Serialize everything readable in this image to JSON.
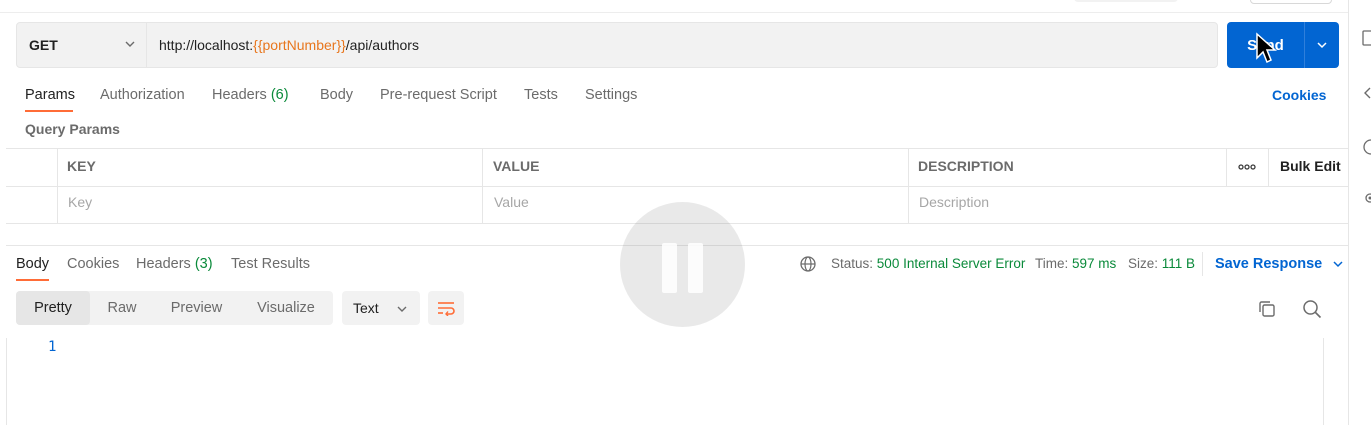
{
  "request": {
    "method": "GET",
    "url_prefix": "http://localhost:",
    "url_variable": "{{portNumber}}",
    "url_suffix": "/api/authors",
    "send_label": "Send"
  },
  "request_tabs": {
    "params": "Params",
    "authorization": "Authorization",
    "headers": "Headers",
    "headers_count": "(6)",
    "body": "Body",
    "pre_request": "Pre-request Script",
    "tests": "Tests",
    "settings": "Settings",
    "cookies": "Cookies"
  },
  "query_params": {
    "title": "Query Params",
    "columns": [
      "KEY",
      "VALUE",
      "DESCRIPTION"
    ],
    "bulk_edit": "Bulk Edit",
    "placeholders": {
      "key": "Key",
      "value": "Value",
      "description": "Description"
    }
  },
  "response_tabs": {
    "body": "Body",
    "cookies": "Cookies",
    "headers": "Headers",
    "headers_count": "(3)",
    "test_results": "Test Results"
  },
  "response_status": {
    "status_label": "Status:",
    "status_code": "500",
    "status_text": "Internal Server Error",
    "time_label": "Time:",
    "time_value": "597 ms",
    "size_label": "Size:",
    "size_value": "111 B",
    "save_response": "Save Response"
  },
  "response_view": {
    "modes": [
      "Pretty",
      "Raw",
      "Preview",
      "Visualize"
    ],
    "active_mode": "Pretty",
    "format": "Text",
    "line_numbers": [
      "1"
    ]
  },
  "colors": {
    "accent_orange": "#ff6c37",
    "primary_blue": "#0265d2",
    "success_green": "#0a8a3a"
  },
  "icons": [
    "chevron-down-icon",
    "more-horizontal-icon",
    "globe-icon",
    "copy-icon",
    "search-icon",
    "wrap-lines-icon",
    "pause-icon",
    "cursor-icon"
  ]
}
